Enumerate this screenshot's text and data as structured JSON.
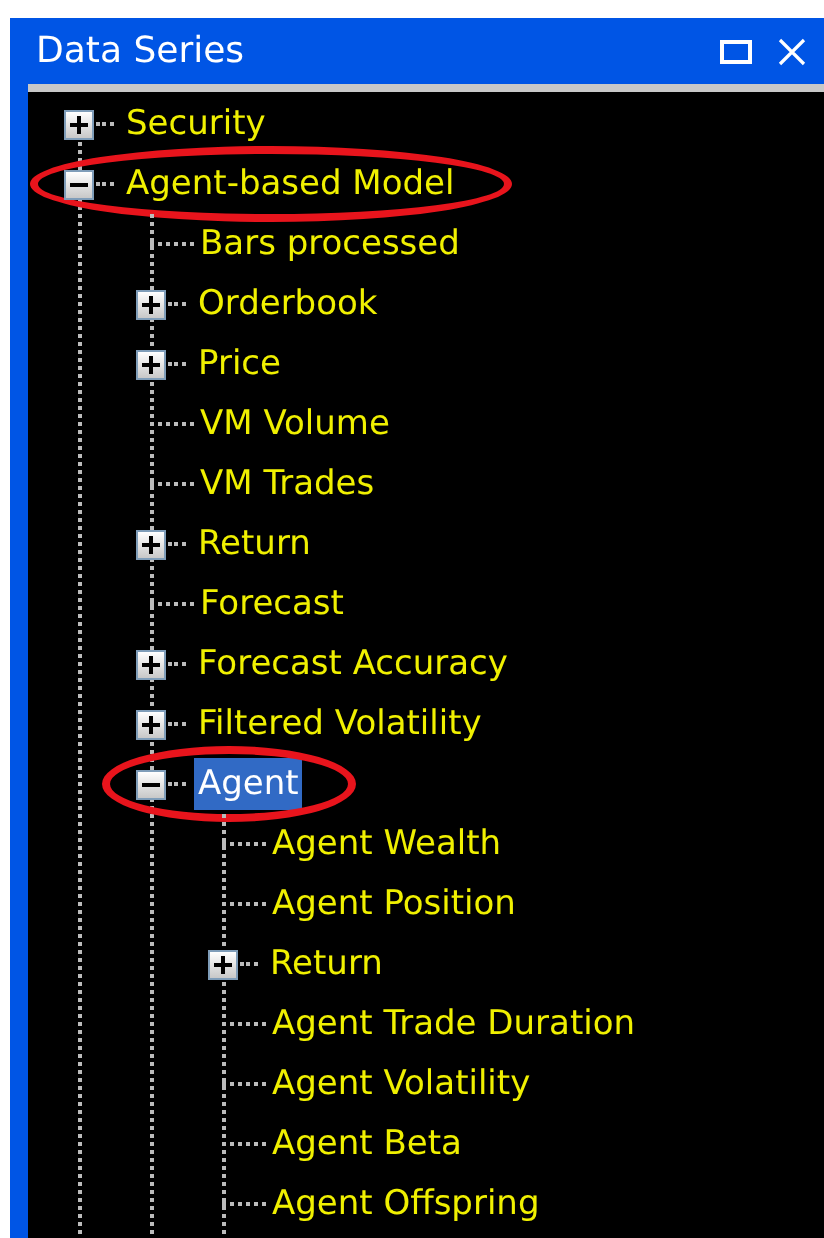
{
  "window": {
    "title": "Data Series"
  },
  "tree": [
    {
      "label": "Security",
      "kind": "node",
      "expanded": false,
      "selected": false,
      "circled": false
    },
    {
      "label": "Agent-based Model",
      "kind": "node",
      "expanded": true,
      "selected": false,
      "circled": true,
      "children": [
        {
          "label": "Bars processed",
          "kind": "leaf",
          "selected": false,
          "circled": false
        },
        {
          "label": "Orderbook",
          "kind": "node",
          "expanded": false,
          "selected": false,
          "circled": false
        },
        {
          "label": "Price",
          "kind": "node",
          "expanded": false,
          "selected": false,
          "circled": false
        },
        {
          "label": "VM Volume",
          "kind": "leaf",
          "selected": false,
          "circled": false
        },
        {
          "label": "VM Trades",
          "kind": "leaf",
          "selected": false,
          "circled": false
        },
        {
          "label": "Return",
          "kind": "node",
          "expanded": false,
          "selected": false,
          "circled": false
        },
        {
          "label": "Forecast",
          "kind": "leaf",
          "selected": false,
          "circled": false
        },
        {
          "label": "Forecast Accuracy",
          "kind": "node",
          "expanded": false,
          "selected": false,
          "circled": false
        },
        {
          "label": "Filtered Volatility",
          "kind": "node",
          "expanded": false,
          "selected": false,
          "circled": false
        },
        {
          "label": "Agent",
          "kind": "node",
          "expanded": true,
          "selected": true,
          "circled": true,
          "children": [
            {
              "label": "Agent Wealth",
              "kind": "leaf",
              "selected": false,
              "circled": false
            },
            {
              "label": "Agent Position",
              "kind": "leaf",
              "selected": false,
              "circled": false
            },
            {
              "label": "Return",
              "kind": "node",
              "expanded": false,
              "selected": false,
              "circled": false
            },
            {
              "label": "Agent Trade Duration",
              "kind": "leaf",
              "selected": false,
              "circled": false
            },
            {
              "label": "Agent Volatility",
              "kind": "leaf",
              "selected": false,
              "circled": false
            },
            {
              "label": "Agent Beta",
              "kind": "leaf",
              "selected": false,
              "circled": false
            },
            {
              "label": "Agent Offspring",
              "kind": "leaf",
              "selected": false,
              "circled": false
            }
          ]
        }
      ]
    }
  ]
}
